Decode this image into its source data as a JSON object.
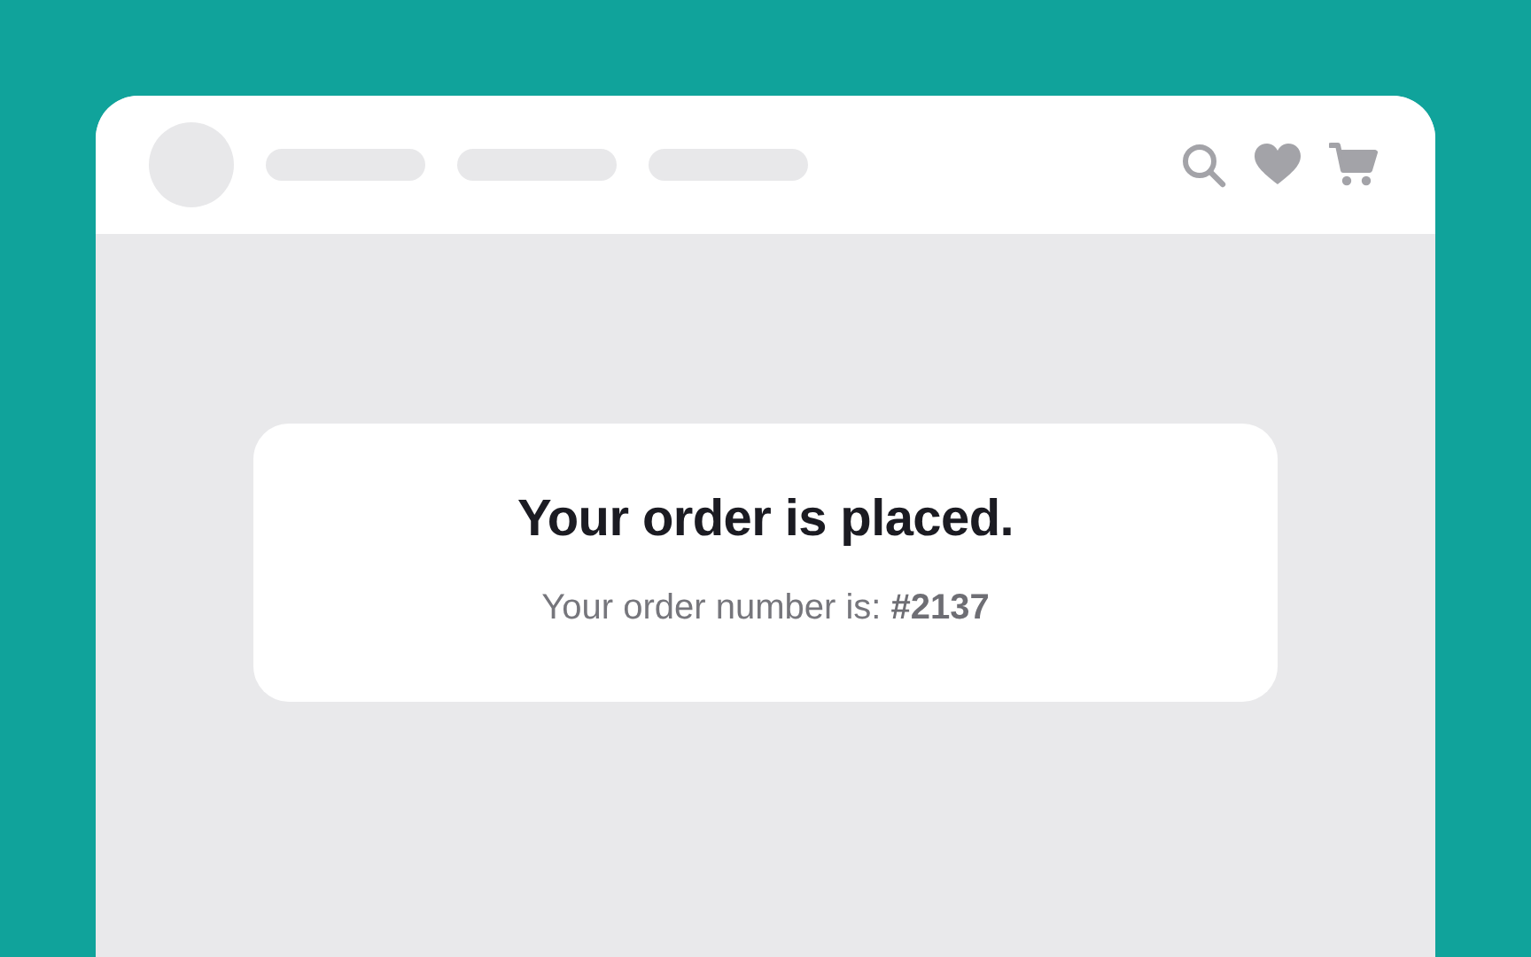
{
  "confirmation": {
    "title": "Your order is placed.",
    "message": "Your order number is: **#2137**"
  }
}
